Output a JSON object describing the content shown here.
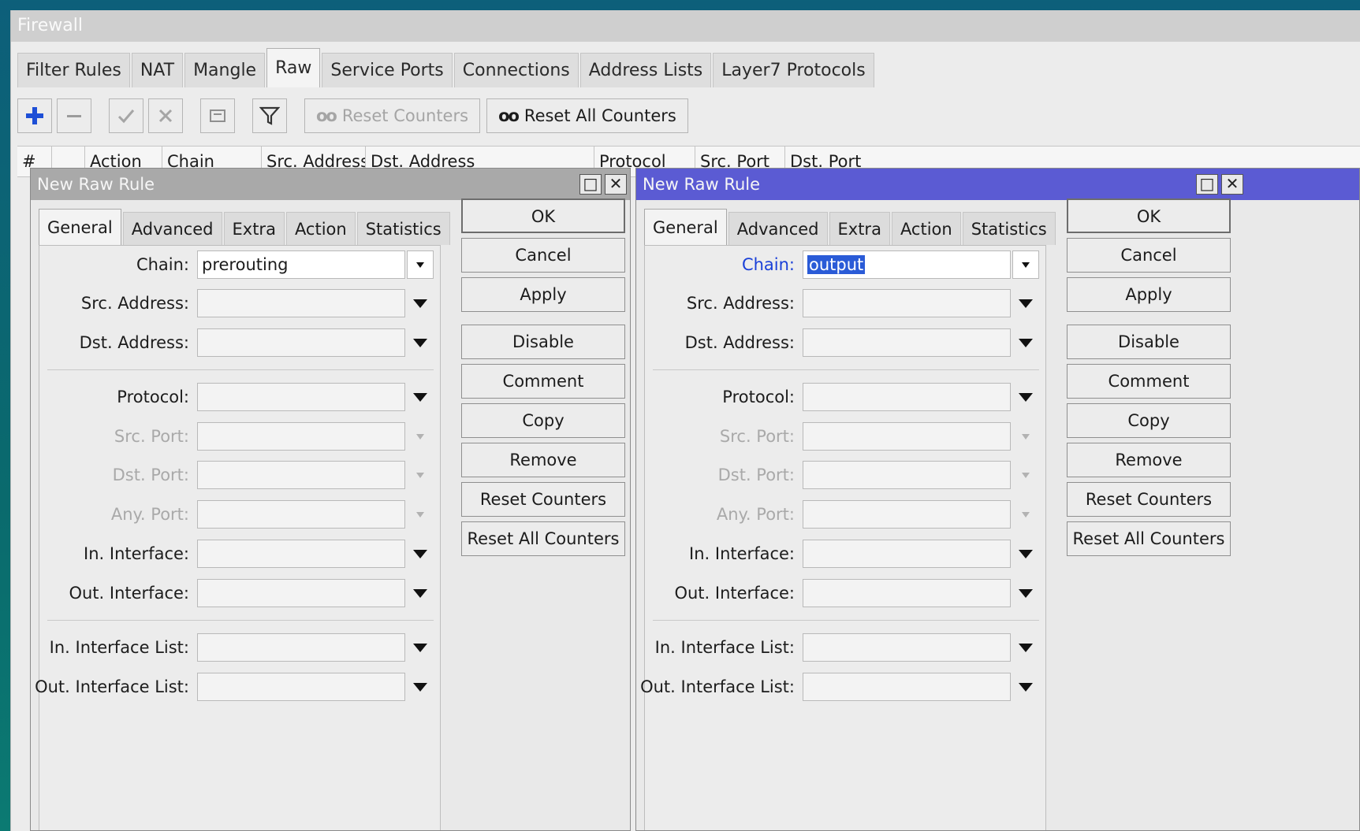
{
  "window": {
    "title": "Firewall"
  },
  "tabs": [
    "Filter Rules",
    "NAT",
    "Mangle",
    "Raw",
    "Service Ports",
    "Connections",
    "Address Lists",
    "Layer7 Protocols"
  ],
  "toolbar": {
    "add_icon": "plus-icon",
    "remove_icon": "minus-icon",
    "reset_counters": "Reset Counters",
    "reset_all_counters": "Reset All Counters",
    "oo_glyph": "oo"
  },
  "table": {
    "columns": [
      "#",
      "",
      "Action",
      "Chain",
      "Src. Address",
      "Dst. Address",
      "Protocol",
      "Src. Port",
      "Dst. Port"
    ]
  },
  "dialogs": [
    {
      "title": "New Raw Rule",
      "tabs": [
        "General",
        "Advanced",
        "Extra",
        "Action",
        "Statistics"
      ],
      "fields": [
        {
          "label": "Chain:",
          "value": "prerouting"
        },
        {
          "label": "Src. Address:",
          "value": ""
        },
        {
          "label": "Dst. Address:",
          "value": ""
        },
        {
          "label": "Protocol:",
          "value": ""
        },
        {
          "label": "Src. Port:",
          "value": ""
        },
        {
          "label": "Dst. Port:",
          "value": ""
        },
        {
          "label": "Any. Port:",
          "value": ""
        },
        {
          "label": "In. Interface:",
          "value": ""
        },
        {
          "label": "Out. Interface:",
          "value": ""
        },
        {
          "label": "In. Interface List:",
          "value": ""
        },
        {
          "label": "Out. Interface List:",
          "value": ""
        }
      ],
      "buttons": [
        "OK",
        "Cancel",
        "Apply",
        "Disable",
        "Comment",
        "Copy",
        "Remove",
        "Reset Counters",
        "Reset All Counters"
      ]
    },
    {
      "title": "New Raw Rule",
      "tabs": [
        "General",
        "Advanced",
        "Extra",
        "Action",
        "Statistics"
      ],
      "fields": [
        {
          "label": "Chain:",
          "value": "output"
        },
        {
          "label": "Src. Address:",
          "value": ""
        },
        {
          "label": "Dst. Address:",
          "value": ""
        },
        {
          "label": "Protocol:",
          "value": ""
        },
        {
          "label": "Src. Port:",
          "value": ""
        },
        {
          "label": "Dst. Port:",
          "value": ""
        },
        {
          "label": "Any. Port:",
          "value": ""
        },
        {
          "label": "In. Interface:",
          "value": ""
        },
        {
          "label": "Out. Interface:",
          "value": ""
        },
        {
          "label": "In. Interface List:",
          "value": ""
        },
        {
          "label": "Out. Interface List:",
          "value": ""
        }
      ],
      "buttons": [
        "OK",
        "Cancel",
        "Apply",
        "Disable",
        "Comment",
        "Copy",
        "Remove",
        "Reset Counters",
        "Reset All Counters"
      ]
    }
  ],
  "window_controls": {
    "maximize_glyph": "□",
    "close_glyph": "✕"
  }
}
